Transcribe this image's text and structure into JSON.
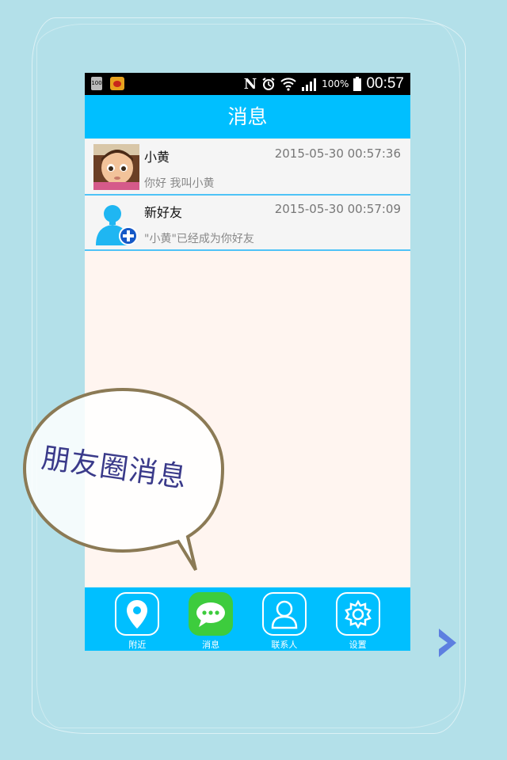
{
  "status_bar": {
    "badge_text": "100",
    "battery": "100%",
    "time": "00:57",
    "n_text": "N"
  },
  "header": {
    "title": "消息"
  },
  "messages": [
    {
      "name": "小黄",
      "time": "2015-05-30 00:57:36",
      "preview": "你好 我叫小黄",
      "avatar": "cartoon-avatar"
    },
    {
      "name": "新好友",
      "time": "2015-05-30 00:57:09",
      "preview": "\"小黄\"已经成为你好友",
      "avatar": "add-friend-avatar"
    }
  ],
  "callout": {
    "text": "朋友圈消息"
  },
  "tabs": [
    {
      "label": "附近",
      "icon": "location-pin-icon",
      "active": false
    },
    {
      "label": "消息",
      "icon": "chat-bubble-icon",
      "active": true
    },
    {
      "label": "联系人",
      "icon": "contact-person-icon",
      "active": false
    },
    {
      "label": "设置",
      "icon": "gear-icon",
      "active": false
    }
  ],
  "colors": {
    "accent": "#00bfff",
    "active_tab": "#3dcc3d",
    "background": "#b3e0e9",
    "content_bg": "#fff5f0"
  }
}
